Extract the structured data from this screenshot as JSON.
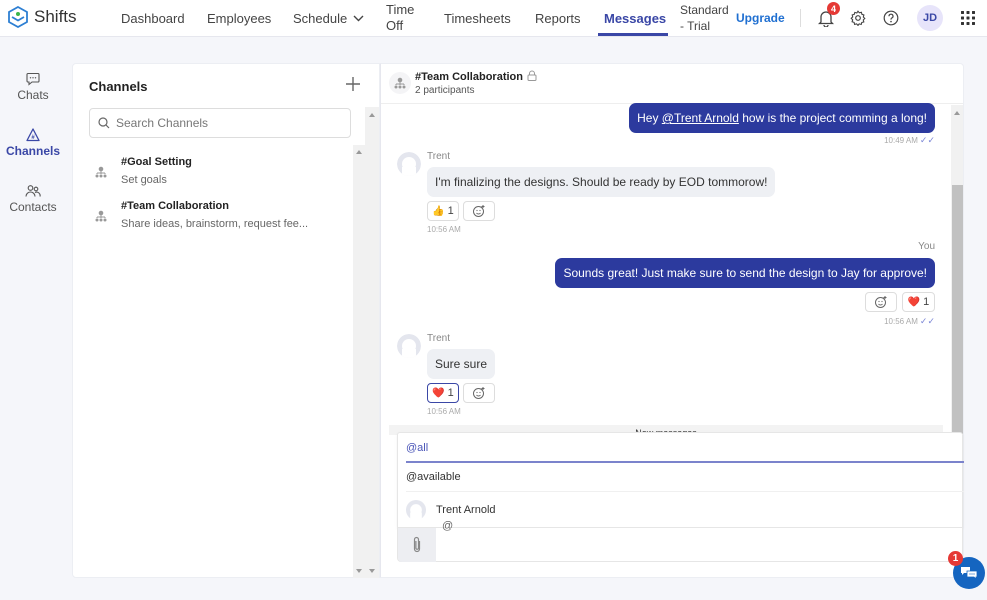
{
  "app": {
    "name": "Shifts",
    "brand_color": "#3a47a6"
  },
  "nav": {
    "items": [
      {
        "label": "Dashboard"
      },
      {
        "label": "Employees"
      },
      {
        "label": "Schedule"
      },
      {
        "label_line1": "Time",
        "label_line2": "Off"
      },
      {
        "label": "Timesheets"
      },
      {
        "label": "Reports"
      },
      {
        "label": "Messages",
        "active": true
      }
    ],
    "plan_line1": "Standard",
    "plan_line2": "- Trial",
    "upgrade_label": "Upgrade",
    "notifications_count": "4",
    "user_initials": "JD"
  },
  "rail": {
    "items": [
      {
        "label": "Chats",
        "icon": "chat-bubble-icon"
      },
      {
        "label": "Channels",
        "icon": "channel-hash-icon",
        "active": true
      },
      {
        "label": "Contacts",
        "icon": "contacts-icon"
      }
    ]
  },
  "channels": {
    "title": "Channels",
    "search_placeholder": "Search Channels",
    "list": [
      {
        "name": "#Goal Setting",
        "description": "Set goals"
      },
      {
        "name": "#Team Collaboration",
        "description": "Share ideas, brainstorm, request fee..."
      }
    ]
  },
  "chat": {
    "title": "#Team Collaboration",
    "participants": "2 participants",
    "messages": [
      {
        "direction": "out",
        "prefix": "Hey ",
        "mention": "@Trent Arnold",
        "suffix": " how is the project comming a long!",
        "time": "10:49 AM"
      },
      {
        "direction": "in",
        "sender": "Trent",
        "text": "I'm finalizing the designs. Should be ready by EOD tommorow!",
        "reaction_emoji": "👍",
        "reaction_count": "1",
        "time": "10:56 AM"
      },
      {
        "direction": "out",
        "sender": "You",
        "text": "Sounds great! Just make sure to send the design to Jay for approve!",
        "reaction_emoji": "❤️",
        "reaction_count": "1",
        "time": "10:56 AM"
      },
      {
        "direction": "in",
        "sender": "Trent",
        "text": "Sure sure",
        "reaction_emoji": "❤️",
        "reaction_count": "1",
        "time": "10:56 AM"
      }
    ],
    "new_messages_label": "New messages"
  },
  "mention_dropdown": {
    "options": [
      {
        "label": "@all"
      },
      {
        "label": "@available"
      },
      {
        "label": "Trent Arnold"
      }
    ]
  },
  "composer": {
    "value": "@"
  },
  "support": {
    "unread_count": "1"
  }
}
